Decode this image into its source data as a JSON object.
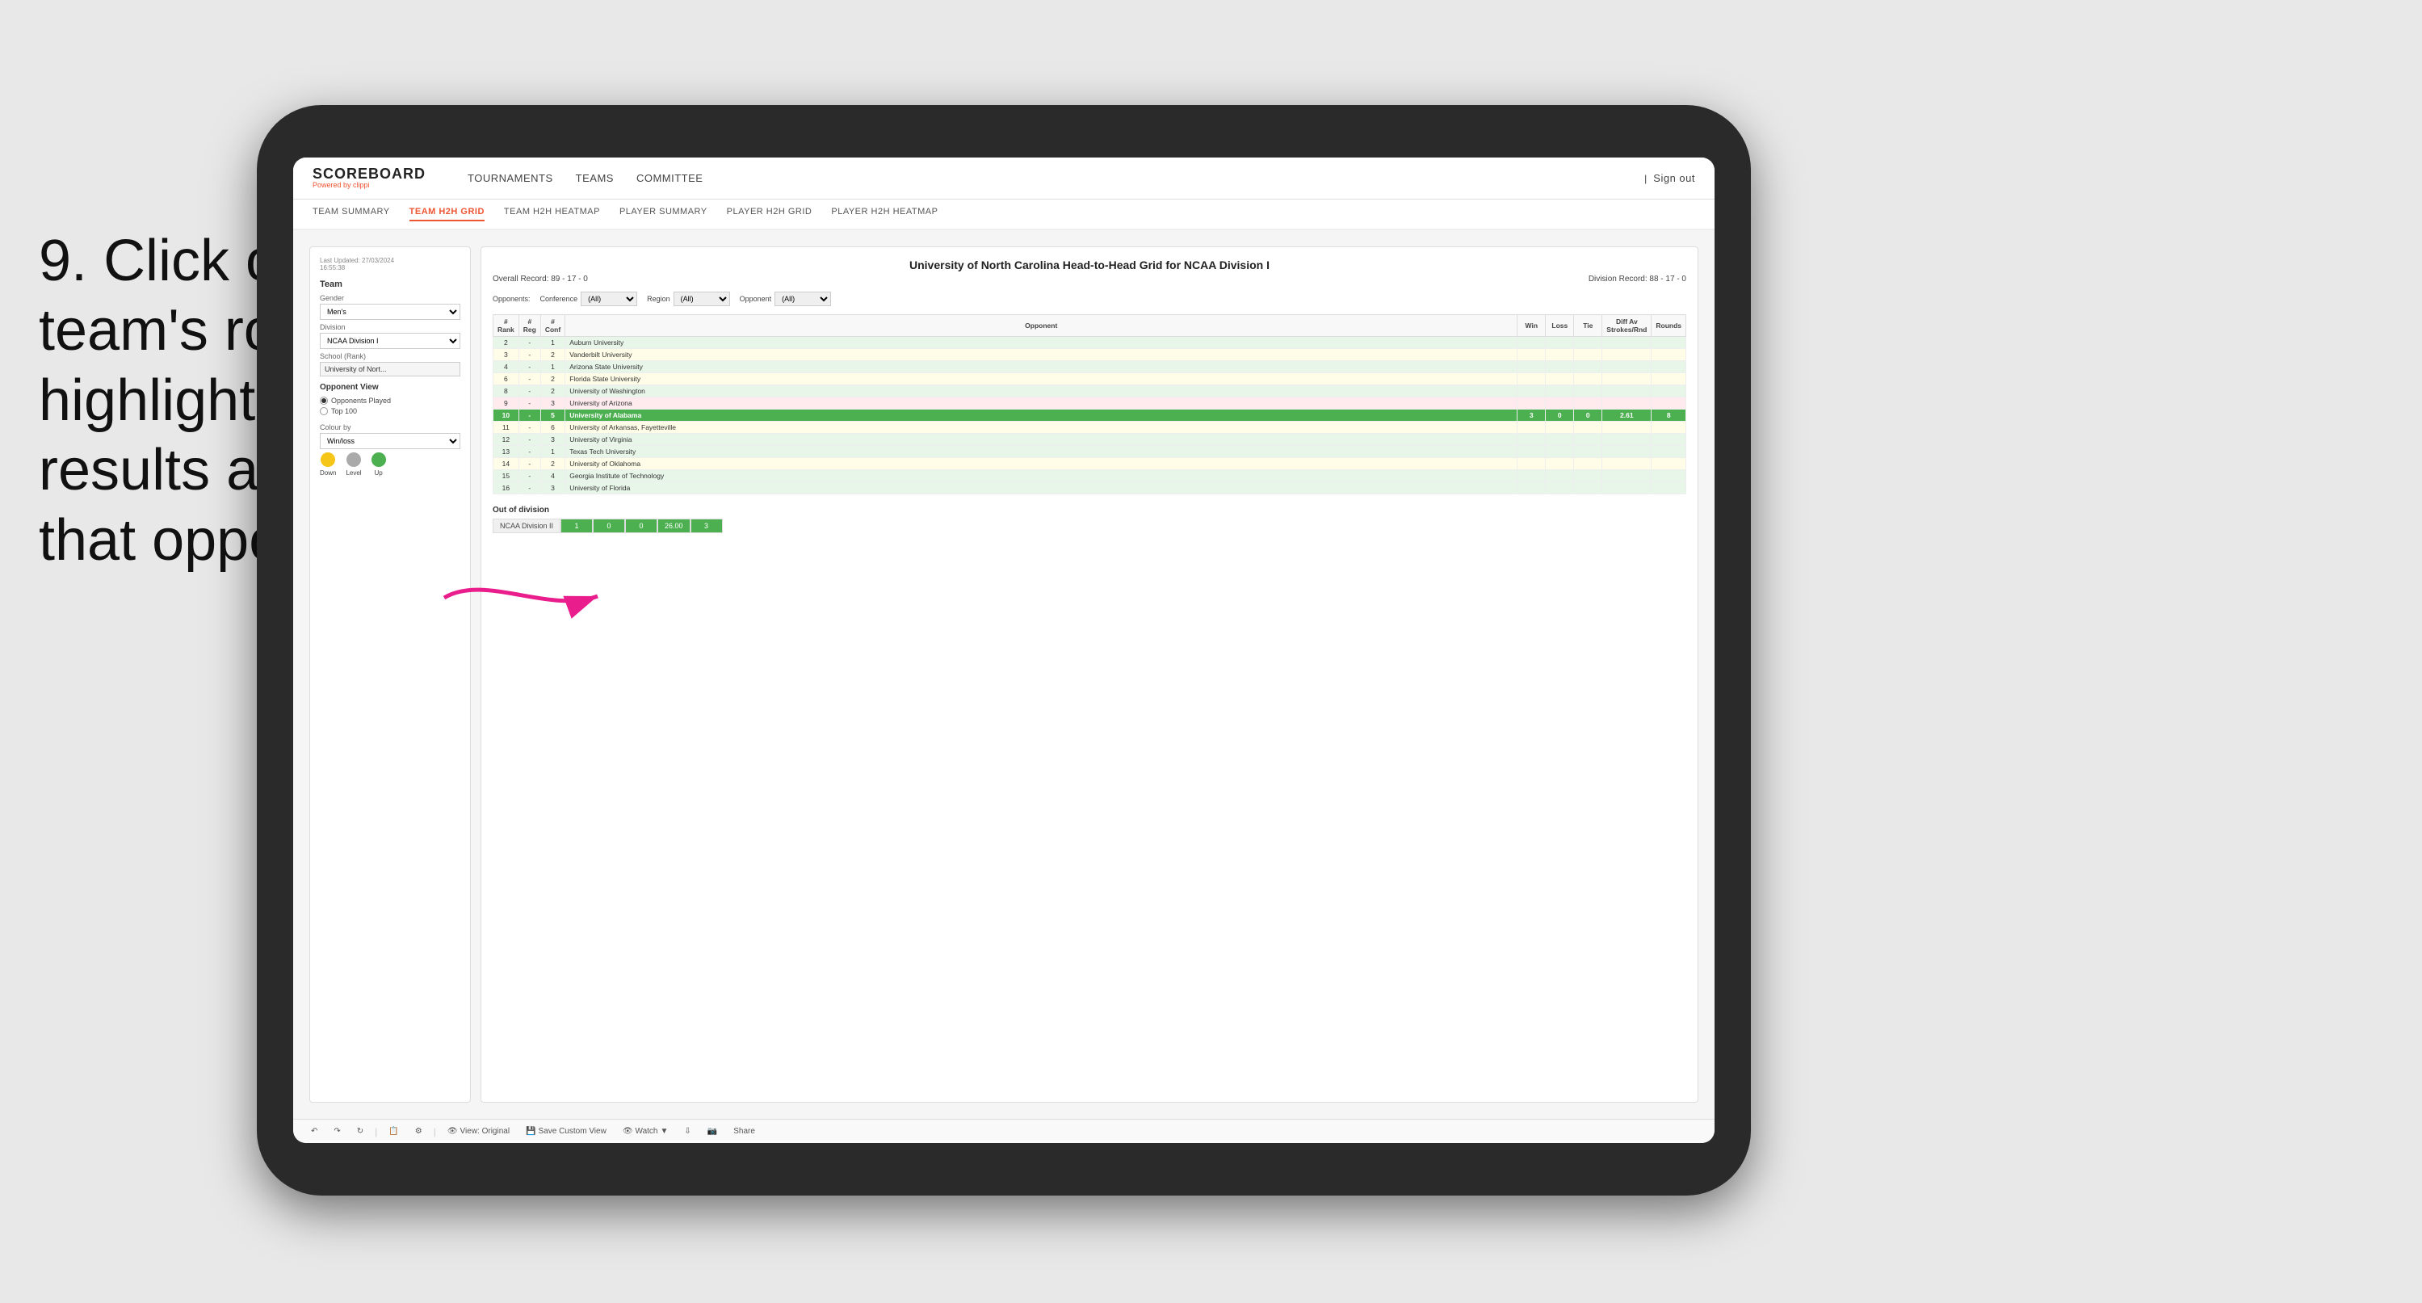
{
  "instruction": {
    "step": "9.",
    "text": "Click on a team's row to highlight results against that opponent"
  },
  "nav": {
    "logo": "SCOREBOARD",
    "logo_sub": "Powered by",
    "logo_brand": "clippi",
    "links": [
      "TOURNAMENTS",
      "TEAMS",
      "COMMITTEE"
    ],
    "sign_in_sep": "|",
    "sign_out": "Sign out"
  },
  "sub_nav": {
    "links": [
      "TEAM SUMMARY",
      "TEAM H2H GRID",
      "TEAM H2H HEATMAP",
      "PLAYER SUMMARY",
      "PLAYER H2H GRID",
      "PLAYER H2H HEATMAP"
    ],
    "active": "TEAM H2H GRID"
  },
  "left_panel": {
    "timestamp_label": "Last Updated: 27/03/2024",
    "timestamp_time": "16:55:38",
    "team_label": "Team",
    "gender_label": "Gender",
    "gender_value": "Men's",
    "division_label": "Division",
    "division_value": "NCAA Division I",
    "school_label": "School (Rank)",
    "school_value": "University of Nort...",
    "opponent_view_label": "Opponent View",
    "radio_1": "Opponents Played",
    "radio_2": "Top 100",
    "colour_by_label": "Colour by",
    "colour_value": "Win/loss",
    "legend": [
      {
        "label": "Down",
        "color": "#f5c518"
      },
      {
        "label": "Level",
        "color": "#aaa"
      },
      {
        "label": "Up",
        "color": "#4caf50"
      }
    ]
  },
  "grid": {
    "title": "University of North Carolina Head-to-Head Grid for NCAA Division I",
    "overall_record_label": "Overall Record:",
    "overall_record": "89 - 17 - 0",
    "division_record_label": "Division Record:",
    "division_record": "88 - 17 - 0",
    "filters": {
      "opponents_label": "Opponents:",
      "conference_label": "Conference",
      "conference_value": "(All)",
      "region_label": "Region",
      "region_value": "(All)",
      "opponent_label": "Opponent",
      "opponent_value": "(All)"
    },
    "columns": [
      "# Rank",
      "# Reg",
      "# Conf",
      "Opponent",
      "Win",
      "Loss",
      "Tie",
      "Diff Av Strokes/Rnd",
      "Rounds"
    ],
    "rows": [
      {
        "rank": "2",
        "reg": "-",
        "conf": "1",
        "opponent": "Auburn University",
        "win": "",
        "loss": "",
        "tie": "",
        "diff": "",
        "rounds": "",
        "style": "light-green"
      },
      {
        "rank": "3",
        "reg": "-",
        "conf": "2",
        "opponent": "Vanderbilt University",
        "win": "",
        "loss": "",
        "tie": "",
        "diff": "",
        "rounds": "",
        "style": "light-yellow"
      },
      {
        "rank": "4",
        "reg": "-",
        "conf": "1",
        "opponent": "Arizona State University",
        "win": "",
        "loss": "",
        "tie": "",
        "diff": "",
        "rounds": "",
        "style": "light-green"
      },
      {
        "rank": "6",
        "reg": "-",
        "conf": "2",
        "opponent": "Florida State University",
        "win": "",
        "loss": "",
        "tie": "",
        "diff": "",
        "rounds": "",
        "style": "light-yellow"
      },
      {
        "rank": "8",
        "reg": "-",
        "conf": "2",
        "opponent": "University of Washington",
        "win": "",
        "loss": "",
        "tie": "",
        "diff": "",
        "rounds": "",
        "style": "light-green"
      },
      {
        "rank": "9",
        "reg": "-",
        "conf": "3",
        "opponent": "University of Arizona",
        "win": "",
        "loss": "",
        "tie": "",
        "diff": "",
        "rounds": "",
        "style": "light-red"
      },
      {
        "rank": "10",
        "reg": "-",
        "conf": "5",
        "opponent": "University of Alabama",
        "win": "3",
        "loss": "0",
        "tie": "0",
        "diff": "2.61",
        "rounds": "8",
        "style": "highlighted"
      },
      {
        "rank": "11",
        "reg": "-",
        "conf": "6",
        "opponent": "University of Arkansas, Fayetteville",
        "win": "",
        "loss": "",
        "tie": "",
        "diff": "",
        "rounds": "",
        "style": "light-yellow"
      },
      {
        "rank": "12",
        "reg": "-",
        "conf": "3",
        "opponent": "University of Virginia",
        "win": "",
        "loss": "",
        "tie": "",
        "diff": "",
        "rounds": "",
        "style": "light-green"
      },
      {
        "rank": "13",
        "reg": "-",
        "conf": "1",
        "opponent": "Texas Tech University",
        "win": "",
        "loss": "",
        "tie": "",
        "diff": "",
        "rounds": "",
        "style": "light-green"
      },
      {
        "rank": "14",
        "reg": "-",
        "conf": "2",
        "opponent": "University of Oklahoma",
        "win": "",
        "loss": "",
        "tie": "",
        "diff": "",
        "rounds": "",
        "style": "light-yellow"
      },
      {
        "rank": "15",
        "reg": "-",
        "conf": "4",
        "opponent": "Georgia Institute of Technology",
        "win": "",
        "loss": "",
        "tie": "",
        "diff": "",
        "rounds": "",
        "style": "light-green"
      },
      {
        "rank": "16",
        "reg": "-",
        "conf": "3",
        "opponent": "University of Florida",
        "win": "",
        "loss": "",
        "tie": "",
        "diff": "",
        "rounds": "",
        "style": "light-green"
      }
    ],
    "out_of_division": {
      "title": "Out of division",
      "label": "NCAA Division II",
      "win": "1",
      "loss": "0",
      "tie": "0",
      "diff": "26.00",
      "rounds": "3"
    }
  },
  "toolbar": {
    "view_original": "View: Original",
    "save_custom": "Save Custom View",
    "watch": "Watch",
    "share": "Share"
  }
}
